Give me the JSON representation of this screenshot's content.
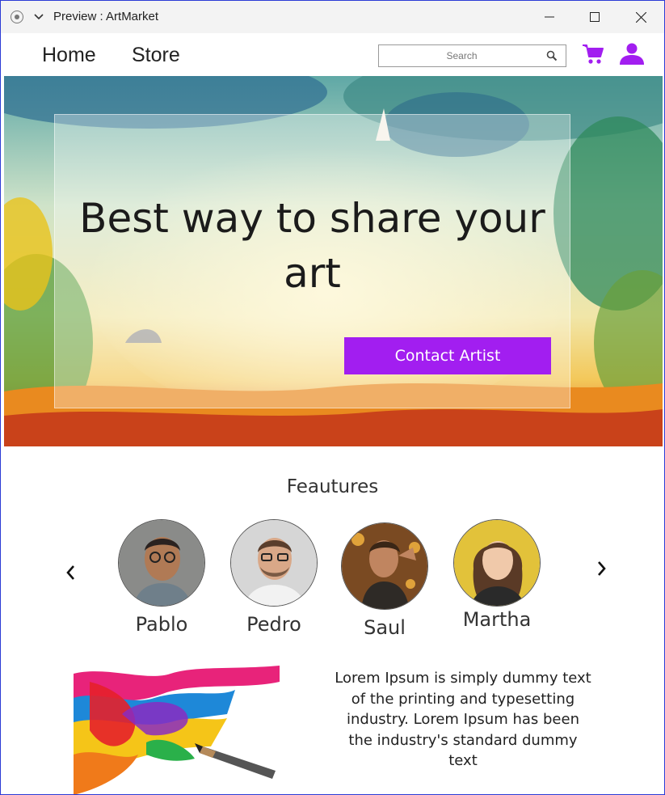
{
  "window": {
    "title": "Preview : ArtMarket"
  },
  "nav": {
    "home": "Home",
    "store": "Store",
    "search_placeholder": "Search"
  },
  "hero": {
    "title": "Best way to share your art",
    "button": "Contact Artist"
  },
  "features": {
    "title": "Feautures",
    "artists": [
      {
        "name": "Pablo"
      },
      {
        "name": "Pedro"
      },
      {
        "name": "Saul"
      },
      {
        "name": "Martha"
      }
    ]
  },
  "about": {
    "text": "Lorem Ipsum is simply dummy text of the printing and typesetting industry. Lorem Ipsum has been the industry's standard dummy text"
  },
  "colors": {
    "accent": "#a21ef0",
    "window_border": "#2b3bd6"
  },
  "icons": [
    "app-icon",
    "chevron-down-icon",
    "minimize-icon",
    "maximize-icon",
    "close-icon",
    "search-icon",
    "cart-icon",
    "user-icon",
    "chevron-left-icon",
    "chevron-right-icon"
  ]
}
